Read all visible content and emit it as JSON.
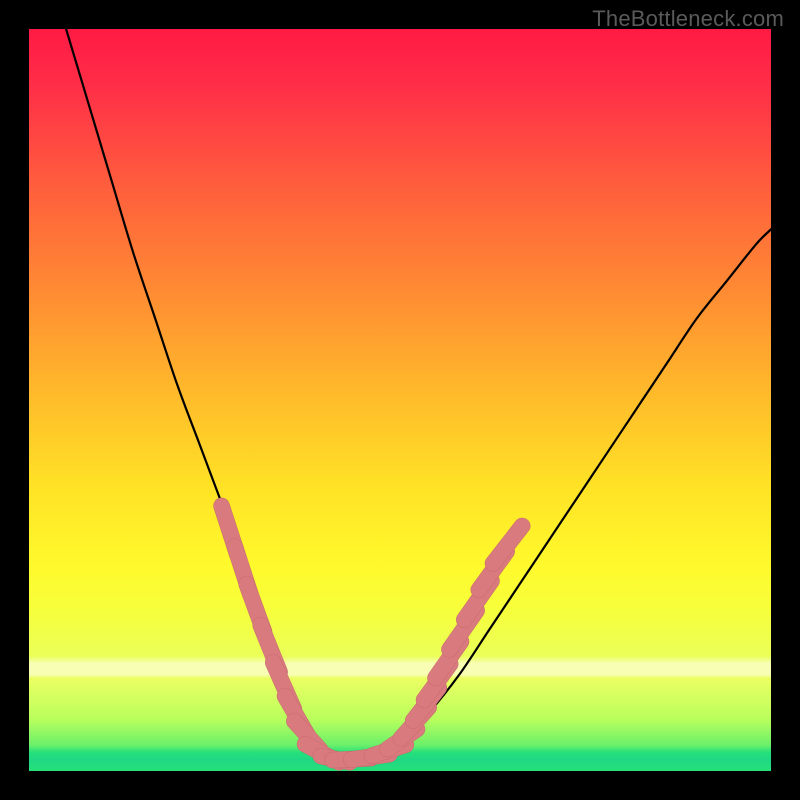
{
  "watermark": "TheBottleneck.com",
  "colors": {
    "frame": "#000000",
    "gradient_stops": [
      {
        "offset": 0.0,
        "color": "#ff1a44"
      },
      {
        "offset": 0.08,
        "color": "#ff2f47"
      },
      {
        "offset": 0.2,
        "color": "#ff5a3e"
      },
      {
        "offset": 0.35,
        "color": "#ff8a33"
      },
      {
        "offset": 0.5,
        "color": "#ffbd2a"
      },
      {
        "offset": 0.62,
        "color": "#ffe326"
      },
      {
        "offset": 0.72,
        "color": "#fff92c"
      },
      {
        "offset": 0.78,
        "color": "#f7ff3a"
      },
      {
        "offset": 0.845,
        "color": "#eaff58"
      },
      {
        "offset": 0.855,
        "color": "#f8ffb4"
      },
      {
        "offset": 0.87,
        "color": "#f8ffb4"
      },
      {
        "offset": 0.875,
        "color": "#ecff62"
      },
      {
        "offset": 0.93,
        "color": "#b9ff5d"
      },
      {
        "offset": 0.965,
        "color": "#6cf06a"
      },
      {
        "offset": 0.975,
        "color": "#26e07a"
      },
      {
        "offset": 0.985,
        "color": "#1fd884"
      },
      {
        "offset": 1.0,
        "color": "#26e07a"
      }
    ],
    "curve": "#000000",
    "marker_fill": "#d97b7e",
    "marker_stroke": "#c96a6e"
  },
  "chart_data": {
    "type": "line",
    "title": "",
    "xlabel": "",
    "ylabel": "",
    "xlim": [
      0,
      100
    ],
    "ylim": [
      0,
      100
    ],
    "series": [
      {
        "name": "bottleneck-curve",
        "x": [
          5,
          8,
          11,
          14,
          17,
          20,
          23,
          26,
          29,
          31,
          33,
          35,
          36.5,
          38,
          40,
          42,
          46,
          50,
          54,
          58,
          62,
          66,
          70,
          74,
          78,
          82,
          86,
          90,
          94,
          98,
          100
        ],
        "y": [
          100,
          90,
          80,
          70,
          61,
          52,
          44,
          36,
          28,
          22,
          17,
          12,
          8,
          5,
          2.5,
          1.5,
          2,
          4,
          8,
          13,
          19,
          25,
          31,
          37,
          43,
          49,
          55,
          61,
          66,
          71,
          73
        ]
      }
    ],
    "markers": {
      "name": "highlighted-points",
      "shape": "capsule",
      "points": [
        {
          "x": 27.0,
          "y": 32.5,
          "len": 3.4,
          "angle": -72
        },
        {
          "x": 28.8,
          "y": 27.0,
          "len": 3.4,
          "angle": -72
        },
        {
          "x": 30.5,
          "y": 22.0,
          "len": 3.4,
          "angle": -70
        },
        {
          "x": 32.5,
          "y": 16.5,
          "len": 3.4,
          "angle": -68
        },
        {
          "x": 34.3,
          "y": 11.5,
          "len": 3.4,
          "angle": -66
        },
        {
          "x": 36.0,
          "y": 7.5,
          "len": 3.0,
          "angle": -60
        },
        {
          "x": 37.5,
          "y": 4.8,
          "len": 2.6,
          "angle": -48
        },
        {
          "x": 39.5,
          "y": 2.4,
          "len": 2.6,
          "angle": -28
        },
        {
          "x": 41.3,
          "y": 1.6,
          "len": 2.0,
          "angle": -12
        },
        {
          "x": 43.5,
          "y": 1.6,
          "len": 2.6,
          "angle": 3
        },
        {
          "x": 46.0,
          "y": 1.9,
          "len": 2.6,
          "angle": 8
        },
        {
          "x": 48.5,
          "y": 2.8,
          "len": 2.4,
          "angle": 18
        },
        {
          "x": 50.3,
          "y": 4.3,
          "len": 2.4,
          "angle": 34
        },
        {
          "x": 52.0,
          "y": 6.5,
          "len": 2.8,
          "angle": 48
        },
        {
          "x": 53.5,
          "y": 9.0,
          "len": 2.8,
          "angle": 52
        },
        {
          "x": 55.0,
          "y": 12.0,
          "len": 3.0,
          "angle": 54
        },
        {
          "x": 56.5,
          "y": 15.0,
          "len": 3.0,
          "angle": 55
        },
        {
          "x": 58.5,
          "y": 19.0,
          "len": 3.2,
          "angle": 55
        },
        {
          "x": 60.5,
          "y": 23.0,
          "len": 3.2,
          "angle": 55
        },
        {
          "x": 62.5,
          "y": 27.0,
          "len": 3.2,
          "angle": 54
        },
        {
          "x": 64.5,
          "y": 30.5,
          "len": 3.2,
          "angle": 52
        }
      ]
    }
  }
}
